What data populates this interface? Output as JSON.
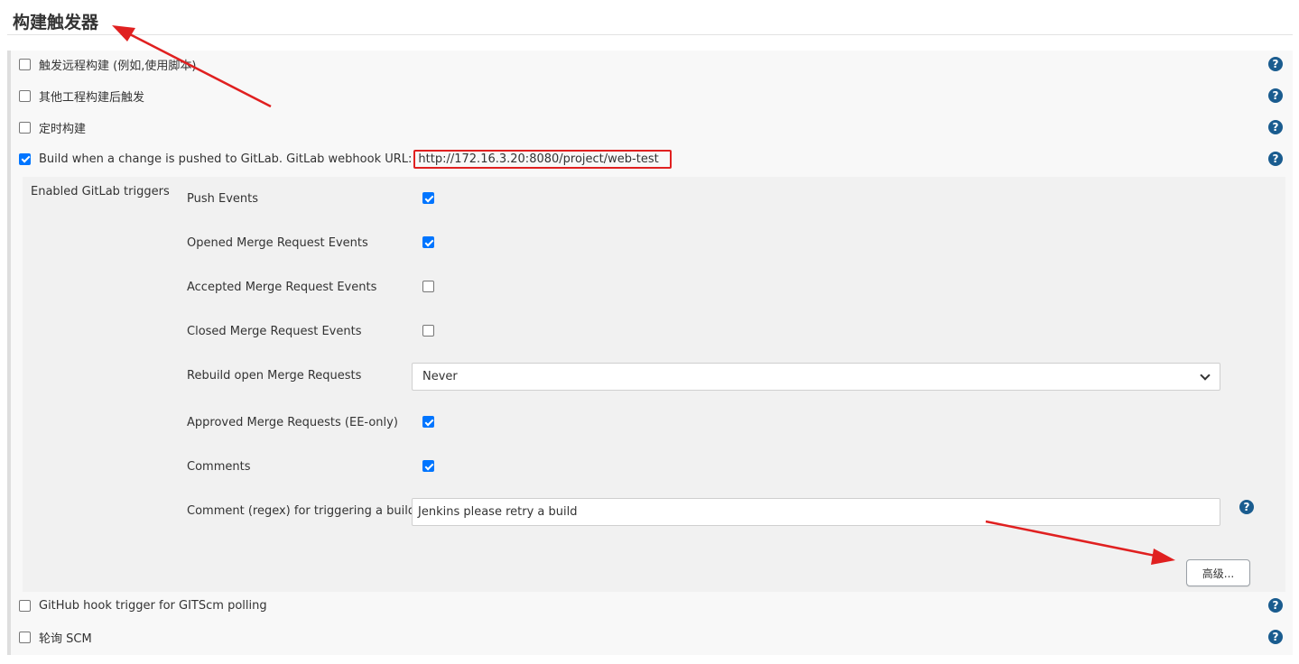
{
  "section": {
    "title": "构建触发器"
  },
  "triggers": [
    {
      "label": "触发远程构建 (例如,使用脚本)",
      "checked": false
    },
    {
      "label": "其他工程构建后触发",
      "checked": false
    },
    {
      "label": "定时构建",
      "checked": false
    },
    {
      "label": "Build when a change is pushed to GitLab. GitLab webhook URL:",
      "checked": true,
      "url": "http://172.16.3.20:8080/project/web-test"
    }
  ],
  "gitlab": {
    "label": "Enabled GitLab triggers",
    "options": [
      {
        "label": "Push Events",
        "checked": true
      },
      {
        "label": "Opened Merge Request Events",
        "checked": true
      },
      {
        "label": "Accepted Merge Request Events",
        "checked": false
      },
      {
        "label": "Closed Merge Request Events",
        "checked": false
      },
      {
        "label": "Rebuild open Merge Requests"
      },
      {
        "label": "Approved Merge Requests (EE-only)",
        "checked": true
      },
      {
        "label": "Comments",
        "checked": true
      },
      {
        "label": "Comment (regex) for triggering a build"
      }
    ],
    "rebuild_select": "Never",
    "comment_regex": "Jenkins please retry a build",
    "advanced_button": "高级..."
  },
  "bottom_triggers": [
    {
      "label": "GitHub hook trigger for GITScm polling",
      "checked": false
    },
    {
      "label": "轮询 SCM",
      "checked": false
    }
  ],
  "help_symbol": "?",
  "colors": {
    "accent": "#0075ff",
    "help": "#1a5c8f",
    "annotation": "#e02020"
  }
}
